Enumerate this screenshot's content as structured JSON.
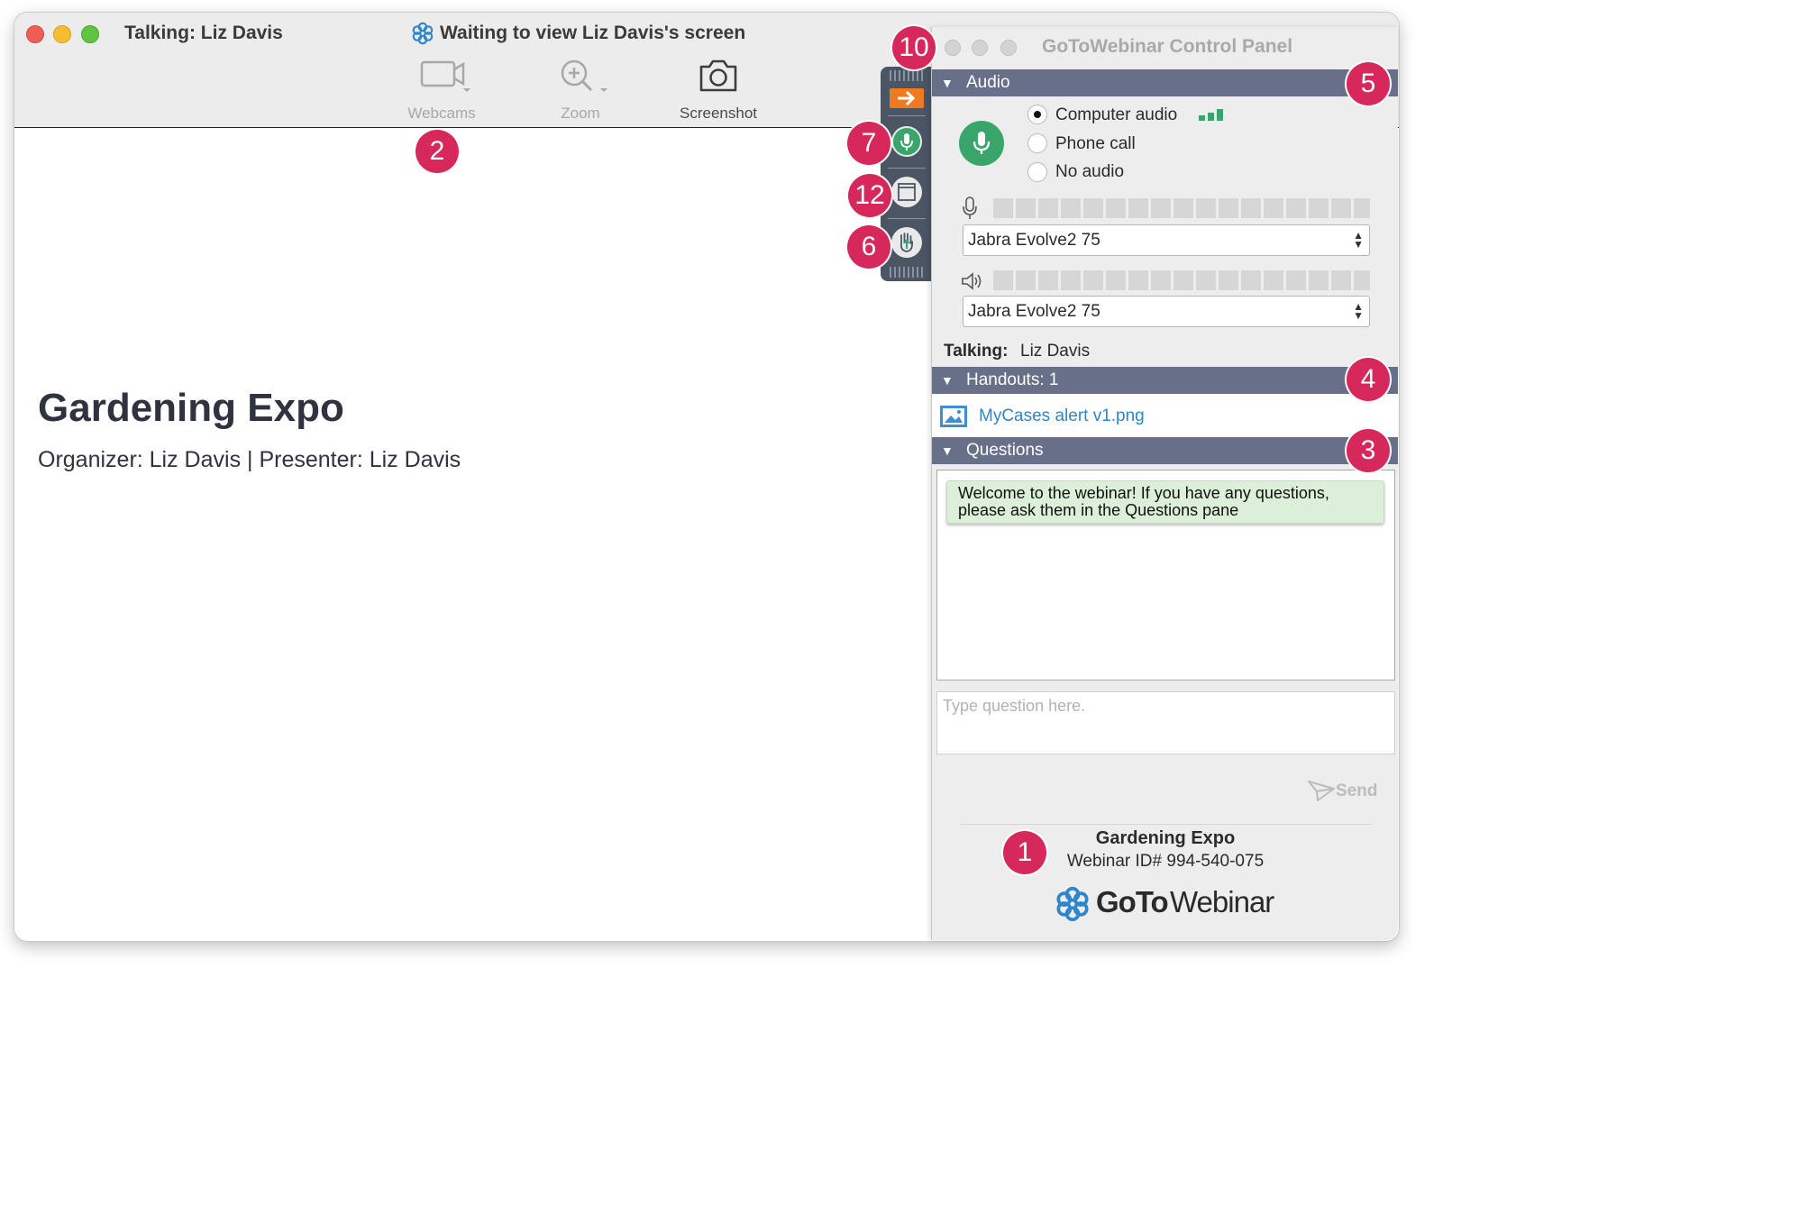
{
  "window": {
    "talking_title": "Talking: Liz Davis",
    "status_title": "Waiting to view Liz Davis's screen"
  },
  "toolbar": {
    "webcams_label": "Webcams",
    "zoom_label": "Zoom",
    "screenshot_label": "Screenshot"
  },
  "badges": [
    "2",
    "10",
    "7",
    "12",
    "6",
    "5",
    "4",
    "3",
    "1"
  ],
  "presentation": {
    "title": "Gardening Expo",
    "subtitle": "Organizer: Liz Davis | Presenter: Liz Davis"
  },
  "control_panel": {
    "title": "GoToWebinar Control Panel",
    "audio": {
      "header": "Audio",
      "options": [
        "Computer audio",
        "Phone call",
        "No audio"
      ],
      "selected": "Computer audio",
      "microphone_device": "Jabra Evolve2 75",
      "speaker_device": "Jabra Evolve2 75",
      "talking_label": "Talking:",
      "talking_name": "Liz Davis"
    },
    "handouts": {
      "header": "Handouts: 1",
      "files": [
        "MyCases alert v1.png"
      ]
    },
    "questions": {
      "header": "Questions",
      "welcome_message": "Welcome to the webinar! If you have any questions, please ask them in the Questions pane",
      "input_placeholder": "Type question here.",
      "send_label": "Send"
    },
    "footer": {
      "event_name": "Gardening Expo",
      "webinar_id": "Webinar ID# 994-540-075",
      "brand_bold": "GoTo",
      "brand_light": "Webinar"
    }
  },
  "colors": {
    "badge": "#d6285a",
    "audio_green": "#3aa56a",
    "section_header": "#687089",
    "orange_arrow": "#f07a22",
    "link_blue": "#2f86c9",
    "welcome_bg": "#dcefd8"
  },
  "icons": [
    "gotowebinar-flower-icon",
    "webcam-icon",
    "zoom-icon",
    "camera-icon",
    "arrow-right-icon",
    "microphone-icon",
    "window-icon",
    "raise-hand-icon",
    "speaker-icon",
    "image-file-icon",
    "send-icon"
  ]
}
